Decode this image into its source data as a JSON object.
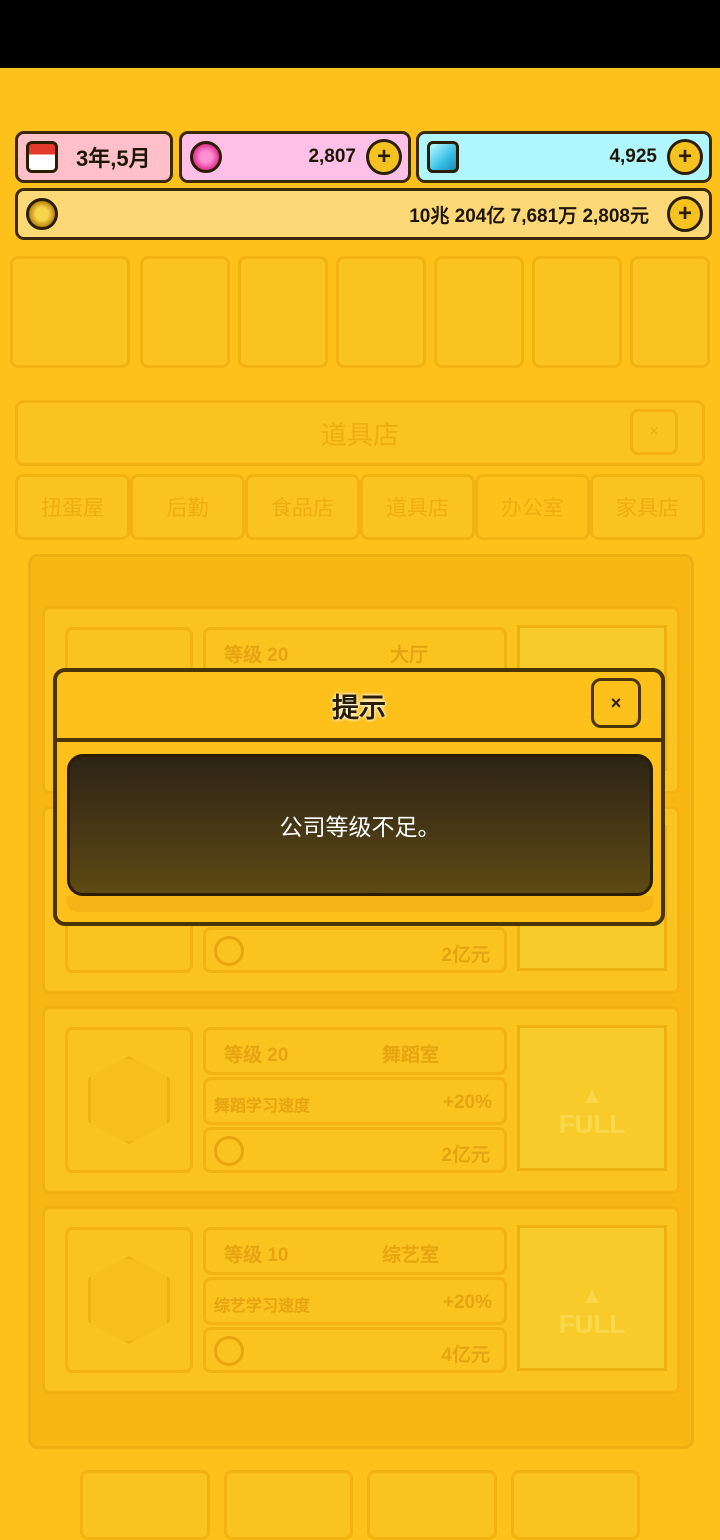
{
  "resources": {
    "date": "3年,5月",
    "gems": "2,807",
    "diamonds": "4,925",
    "money": "10兆 204亿 7,681万 2,808元"
  },
  "shop": {
    "title": "道具店",
    "tabs": [
      "扭蛋屋",
      "后勤",
      "食品店",
      "道具店",
      "办公室",
      "家具店"
    ],
    "cards": [
      {
        "level": "等级 20",
        "name": "大厅",
        "stat_label": "",
        "stat_value": "",
        "cost": ""
      },
      {
        "level": "",
        "name": "",
        "stat_label": "",
        "stat_value": "",
        "cost": "2亿元"
      },
      {
        "level": "等级 20",
        "name": "舞蹈室",
        "stat_label": "舞蹈学习速度",
        "stat_value": "+20%",
        "cost": "2亿元"
      },
      {
        "level": "等级 10",
        "name": "综艺室",
        "stat_label": "综艺学习速度",
        "stat_value": "+20%",
        "cost": "4亿元"
      }
    ],
    "full_label": "FULL"
  },
  "dialog": {
    "title": "提示",
    "message": "公司等级不足。",
    "close": "×"
  },
  "icons": {
    "calendar": "calendar-icon",
    "gem": "gem-icon",
    "diamond": "diamond-icon",
    "coin": "coin-icon",
    "plus": "+"
  },
  "colors": {
    "background": "#fec01a",
    "dialog_body": "#3a2e14",
    "gem_bar": "#ffc0e8",
    "diamond_bar": "#aff6ff",
    "money_bar": "#fcd877"
  }
}
